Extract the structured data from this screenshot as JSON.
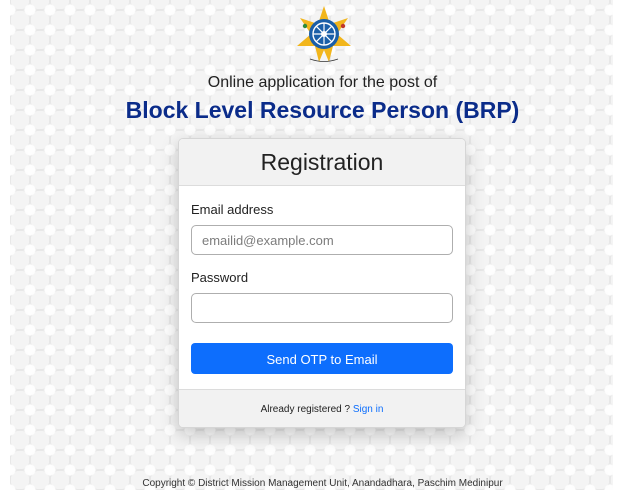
{
  "header": {
    "logo_icon": "anandadhara-wheel-logo",
    "logo_caption": "আনন্দধারা",
    "subtitle": "Online application for the post of",
    "title": "Block Level Resource Person (BRP)"
  },
  "registration_card": {
    "heading": "Registration",
    "email_label": "Email address",
    "email_placeholder": "emailid@example.com",
    "email_value": "",
    "password_label": "Password",
    "password_value": "",
    "submit_label": "Send OTP to Email",
    "footer_text": "Already registered ? ",
    "signin_link": "Sign in"
  },
  "footer": {
    "copyright": "Copyright © District Mission Management Unit, Anandadhara, Paschim Medinipur"
  },
  "colors": {
    "title_blue": "#0b2c8a",
    "button_blue": "#0d6efd",
    "logo_gold": "#f2b61c",
    "logo_blue": "#1a5fa8"
  }
}
